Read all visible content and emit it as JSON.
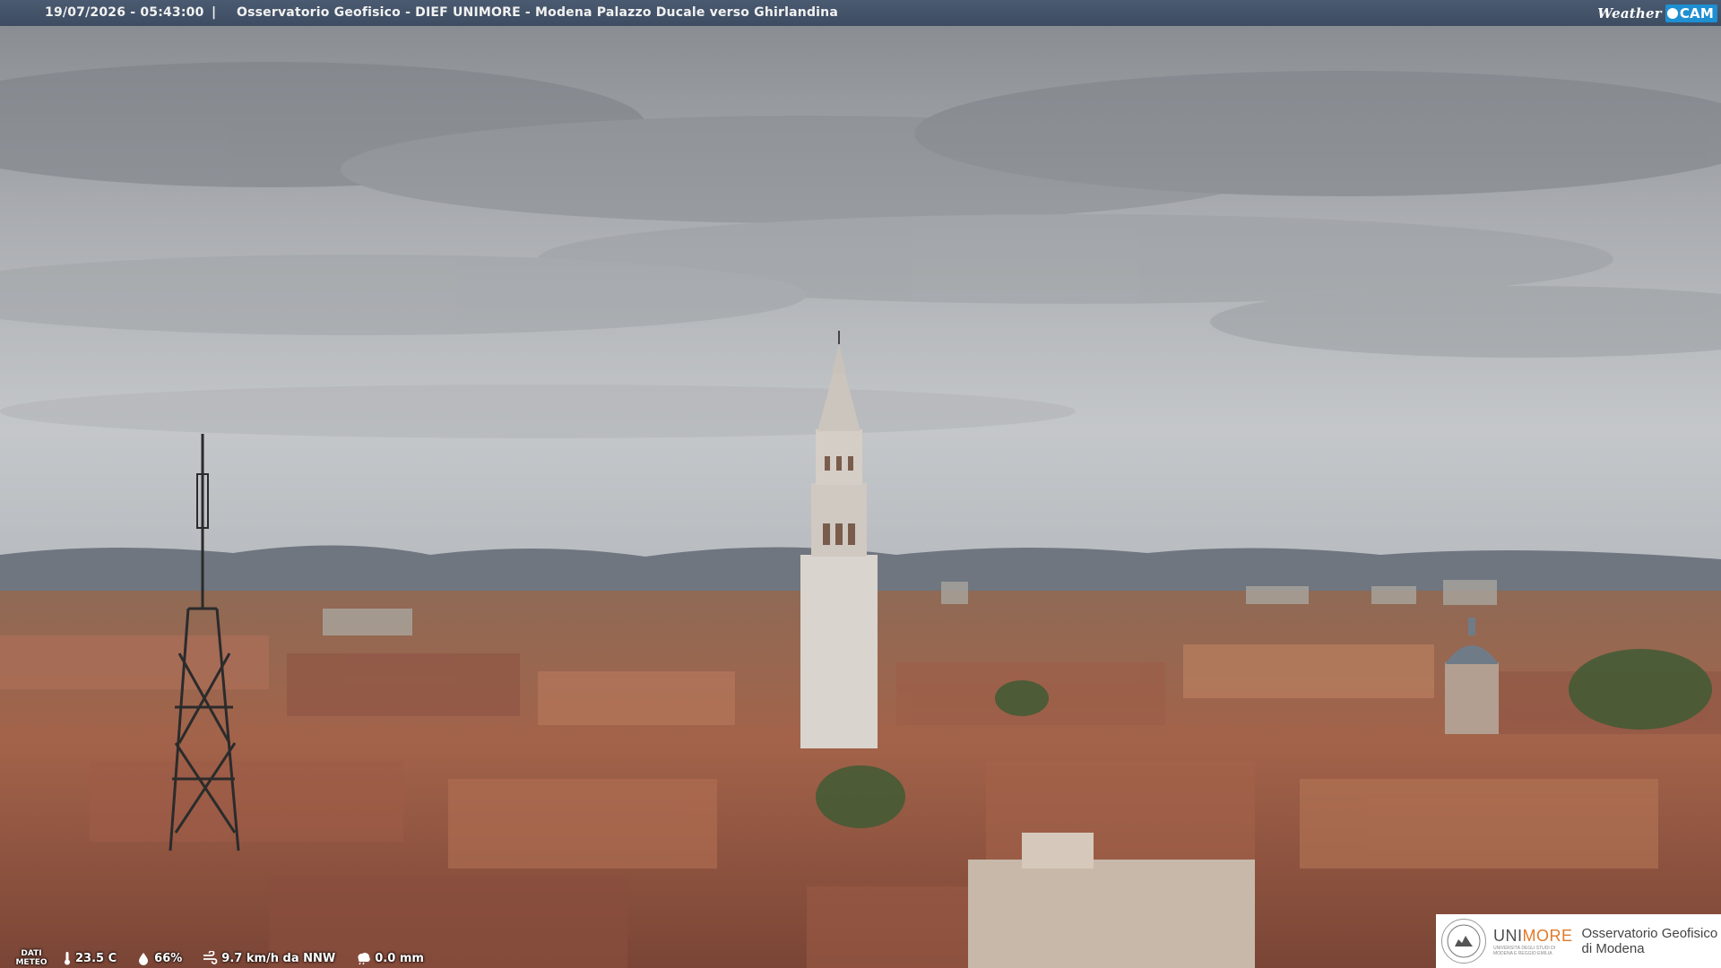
{
  "topbar": {
    "timestamp": "19/07/2026 - 05:43:00",
    "separator": "|",
    "title": "Osservatorio Geofisico - DIEF UNIMORE - Modena Palazzo Ducale verso Ghirlandina"
  },
  "brand": {
    "weather": "Weather",
    "cam": "CAM",
    "color": "#1e8fd1"
  },
  "meteo": {
    "label_line1": "DATI",
    "label_line2": "METEO",
    "temperature": "23.5 C",
    "humidity": "66%",
    "wind": "9.7 km/h da NNW",
    "rain": "0.0 mm",
    "icons": [
      "thermometer-icon",
      "humidity-drop-icon",
      "wind-icon",
      "rain-icon"
    ]
  },
  "logo": {
    "name_a": "UNI",
    "name_b": "MORE",
    "sub_line1": "UNIVERSITÀ DEGLI STUDI DI",
    "sub_line2": "MODENA E REGGIO EMILIA",
    "obs_line1": "Osservatorio Geofisico",
    "obs_line2": "di Modena",
    "accent": "#e07a2a"
  },
  "scene": {
    "sky_color": "#b9bcc0",
    "roof_color": "#a5644a"
  }
}
